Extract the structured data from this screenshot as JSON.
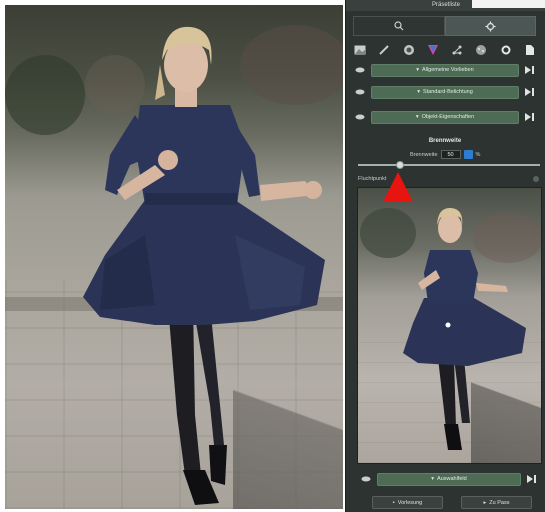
{
  "panel": {
    "title": "Präsetliste"
  },
  "tabs": [
    {
      "icon": "search-icon"
    },
    {
      "icon": "gear-icon"
    }
  ],
  "toolbar": {
    "tools": [
      "image-icon",
      "brush-icon",
      "circle-gradient-icon",
      "color-filter-icon",
      "nodes-icon",
      "texture-icon",
      "settings-icon",
      "document-icon"
    ]
  },
  "adjustment_rows": [
    {
      "label": "Allgemeine Vorlieben"
    },
    {
      "label": "Standard-Belichtung"
    },
    {
      "label": "Objekt-Eigenschaften"
    }
  ],
  "section": {
    "title": "Brennweite",
    "sub_label": "Brennweite",
    "value": "50",
    "unit": "%"
  },
  "slider": {
    "value": 0.22
  },
  "preview": {
    "label": "Fluchtpunkt"
  },
  "bottom_row": {
    "label": "Auswahlfeld"
  },
  "footer": {
    "left_label": "Vorlesung",
    "right_label": "Zu Pass"
  },
  "colors": {
    "panel_bg": "#2d3331",
    "pill_green": "#4d6b55",
    "marker_red": "#e8140f",
    "toggle_blue": "#2e7dd1"
  }
}
